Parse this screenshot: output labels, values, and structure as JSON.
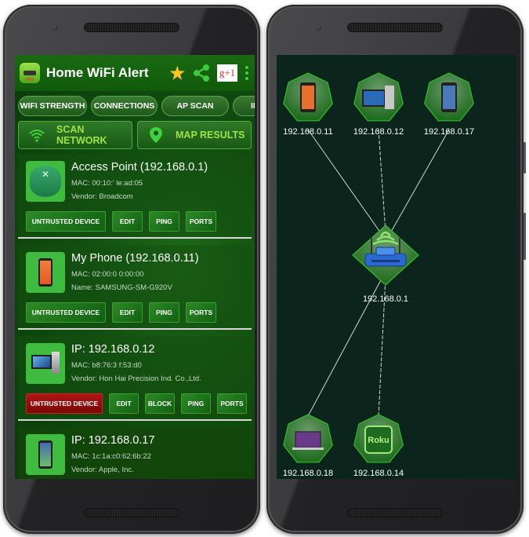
{
  "app": {
    "title": "Home WiFi Alert",
    "icon_badge": "PRO",
    "header_icons": [
      "star-icon",
      "share-icon",
      "google-plus-one-icon",
      "overflow-menu-icon"
    ],
    "gplus_label": "g+1"
  },
  "tabs": [
    {
      "label": "WIFI STRENGTH"
    },
    {
      "label": "CONNECTIONS"
    },
    {
      "label": "AP SCAN"
    },
    {
      "label": "IP"
    }
  ],
  "actions": {
    "scan": {
      "label": "SCAN NETWORK",
      "icon": "wifi-icon"
    },
    "map": {
      "label": "MAP RESULTS",
      "icon": "map-pin-icon"
    }
  },
  "colors": {
    "accent_text": "#9fe24a",
    "untrusted_red": "#b01414",
    "map_bg": "#0c251c"
  },
  "devices": [
    {
      "title": "Access Point (192.168.0.1)",
      "line1": "MAC: 00:10:'     le:ad:05",
      "line2": "Vendor:  Broadcom",
      "icon": "router-icon",
      "buttons": [
        "UNTRUSTED DEVICE",
        "EDIT",
        "PING",
        "PORTS"
      ],
      "untrusted_highlight": false
    },
    {
      "title": "My Phone (192.168.0.11)",
      "line1": "MAC:  02:00:0     0:00:00",
      "line2": "Name: SAMSUNG-SM-G920V",
      "icon": "android-phone-icon",
      "buttons": [
        "UNTRUSTED DEVICE",
        "EDIT",
        "PING",
        "PORTS"
      ],
      "untrusted_highlight": false
    },
    {
      "title": "IP: 192.168.0.12",
      "line1": "MAC:  b8:76:3     f:53:d0",
      "line2": "Vendor:  Hon Hai Precision Ind. Co.,Ltd.",
      "icon": "desktop-computer-icon",
      "buttons": [
        "UNTRUSTED DEVICE",
        "EDIT",
        "BLOCK",
        "PING",
        "PORTS"
      ],
      "untrusted_highlight": true
    },
    {
      "title": "IP: 192.168.0.17",
      "line1": "MAC:  1c:1a:c0:62:6b:22",
      "line2": "Vendor:  Apple, Inc.",
      "icon": "iphone-icon",
      "buttons": [],
      "untrusted_highlight": false
    }
  ],
  "map": {
    "router": {
      "label": "192.168.0.1",
      "icon": "wifi-router-icon"
    },
    "nodes": [
      {
        "label": "192.168.0.11",
        "icon": "android-phone-icon",
        "link": "solid"
      },
      {
        "label": "192.168.0.12",
        "icon": "desktop-computer-icon",
        "link": "dashed"
      },
      {
        "label": "192.168.0.17",
        "icon": "iphone-icon",
        "link": "solid"
      },
      {
        "label": "192.168.0.18",
        "icon": "macbook-icon",
        "link": "solid"
      },
      {
        "label": "192.168.0.14",
        "icon": "roku-icon",
        "link": "dashed",
        "text": "Roku"
      }
    ]
  }
}
